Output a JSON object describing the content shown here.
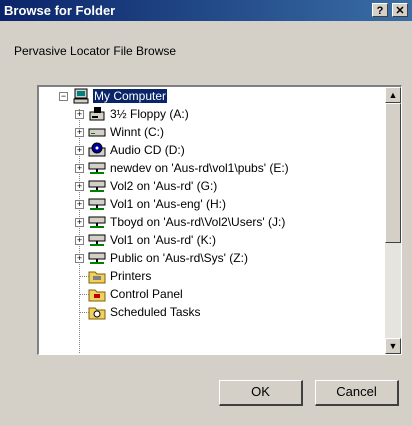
{
  "window": {
    "title": "Browse for Folder",
    "help_label": "?",
    "close_label": "✕"
  },
  "description": "Pervasive Locator File Browse",
  "tree": {
    "items": [
      {
        "label": "My Computer",
        "icon": "my-computer-icon",
        "expander": "−"
      },
      {
        "label": "3½ Floppy (A:)",
        "icon": "floppy-drive-icon",
        "expander": "+"
      },
      {
        "label": "Winnt (C:)",
        "icon": "hard-drive-icon",
        "expander": "+"
      },
      {
        "label": "Audio CD (D:)",
        "icon": "cd-drive-icon",
        "expander": "+"
      },
      {
        "label": "newdev on 'Aus-rd\\vol1\\pubs' (E:)",
        "icon": "network-drive-icon",
        "expander": "+"
      },
      {
        "label": "Vol2 on 'Aus-rd' (G:)",
        "icon": "network-drive-icon",
        "expander": "+"
      },
      {
        "label": "Vol1 on 'Aus-eng' (H:)",
        "icon": "network-drive-icon",
        "expander": "+"
      },
      {
        "label": "Tboyd on 'Aus-rd\\Vol2\\Users' (J:)",
        "icon": "network-drive-icon",
        "expander": "+"
      },
      {
        "label": "Vol1 on 'Aus-rd' (K:)",
        "icon": "network-drive-icon",
        "expander": "+"
      },
      {
        "label": "Public on 'Aus-rd\\Sys' (Z:)",
        "icon": "network-drive-icon",
        "expander": "+"
      },
      {
        "label": "Printers",
        "icon": "printers-folder-icon",
        "expander": ""
      },
      {
        "label": "Control Panel",
        "icon": "control-panel-icon",
        "expander": ""
      },
      {
        "label": "Scheduled Tasks",
        "icon": "scheduled-tasks-icon",
        "expander": ""
      }
    ]
  },
  "buttons": {
    "ok": "OK",
    "cancel": "Cancel"
  },
  "scrollbar": {
    "up_arrow": "▲",
    "down_arrow": "▼"
  }
}
